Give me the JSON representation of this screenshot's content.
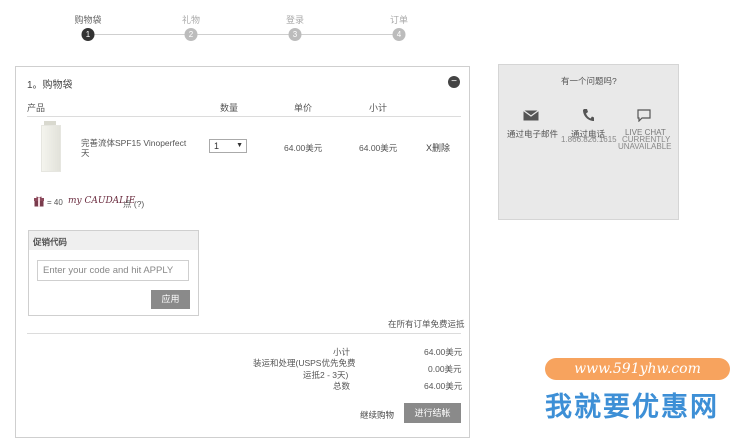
{
  "steps": [
    {
      "label": "购物袋",
      "number": "1",
      "active": true
    },
    {
      "label": "礼物",
      "number": "2",
      "active": false
    },
    {
      "label": "登录",
      "number": "3",
      "active": false
    },
    {
      "label": "订单",
      "number": "4",
      "active": false
    }
  ],
  "cart": {
    "title": "1。购物袋",
    "collapse_symbol": "−",
    "headers": {
      "product": "产品",
      "qty": "数量",
      "price": "单价",
      "subtotal": "小计"
    },
    "item": {
      "name_line1": "完善流体SPF15 Vinoperfect",
      "name_line2": "天",
      "qty": "1",
      "price": "64.00美元",
      "subtotal": "64.00美元",
      "remove": "X删除"
    },
    "points": {
      "prefix": "= 40",
      "brand": "my CAUDALIE",
      "suffix": "点 (?)"
    }
  },
  "promo": {
    "title": "促销代码",
    "placeholder": "Enter your code and hit APPLY",
    "apply_label": "应用"
  },
  "free_shipping": "在所有订单免费运抵",
  "summary": {
    "subtotal_label": "小计",
    "subtotal_value": "64.00美元",
    "shipping_label_line1": "装运和处理(USPS优先免费",
    "shipping_label_line2": "运抵2 - 3天)",
    "shipping_value": "0.00美元",
    "total_label": "总数",
    "total_value": "64.00美元"
  },
  "actions": {
    "continue": "继续购物",
    "checkout": "进行结帐"
  },
  "help": {
    "title": "有一个问题吗?",
    "email_label": "通过电子邮件",
    "phone_label": "通过电话",
    "phone_number": "1.866.826.1615",
    "chat_line1": "LIVE CHAT",
    "chat_line2": "CURRENTLY",
    "chat_line3": "UNAVAILABLE"
  },
  "watermark": {
    "url": "www.591yhw.com",
    "text": "我就要优惠网"
  },
  "colors": {
    "accent_dark": "#333333",
    "button_gray": "#8a8a8a",
    "help_bg": "#e9e9e9",
    "watermark_orange": "#f7a35e",
    "watermark_blue": "#3d8fd6"
  }
}
